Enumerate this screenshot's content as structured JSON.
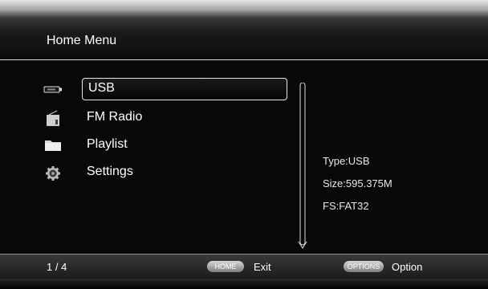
{
  "header": {
    "title": "Home Menu"
  },
  "menu": {
    "items": [
      {
        "label": "USB",
        "icon": "usb-icon",
        "selected": true
      },
      {
        "label": "FM Radio",
        "icon": "radio-icon",
        "selected": false
      },
      {
        "label": "Playlist",
        "icon": "folder-icon",
        "selected": false
      },
      {
        "label": "Settings",
        "icon": "gear-icon",
        "selected": false
      }
    ]
  },
  "info": {
    "type": "Type:USB",
    "size": "Size:595.375M",
    "fs": "FS:FAT32"
  },
  "footer": {
    "page": "1 / 4",
    "home_button": "HOME",
    "exit_label": "Exit",
    "options_button": "OPTIONS",
    "option_label": "Option"
  }
}
